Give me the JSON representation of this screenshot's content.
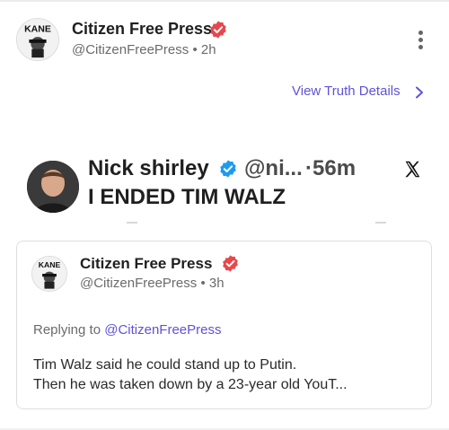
{
  "post": {
    "author_name": "Citizen Free Press",
    "author_handle": "@CitizenFreePress",
    "separator": "•",
    "time": "2h",
    "avatar_icon": "kane-avatar-icon",
    "verified_icon": "verified-badge-icon",
    "more_icon": "more-vertical-icon"
  },
  "truth_details": {
    "label": "View Truth Details",
    "chevron_icon": "chevron-right-icon"
  },
  "embedded_tweet": {
    "author_name": "Nick shirley",
    "handle_truncated": "@ni...",
    "separator": "·",
    "time": "56m",
    "text": "I ENDED TIM WALZ",
    "platform_icon": "x-logo-icon"
  },
  "quoted_post": {
    "author_name": "Citizen Free Press",
    "author_handle": "@CitizenFreePress",
    "separator": "•",
    "time": "3h",
    "replying_prefix": "Replying to",
    "replying_to": "@CitizenFreePress",
    "text_line1": "Tim Walz said he could stand up to Putin.",
    "text_line2": "Then he was taken down by a 23-year old YouT..."
  },
  "colors": {
    "accent": "#5f52d9",
    "verified": "#e5484d",
    "text_primary": "#1f1f1f",
    "text_secondary": "#6b6b6b"
  }
}
